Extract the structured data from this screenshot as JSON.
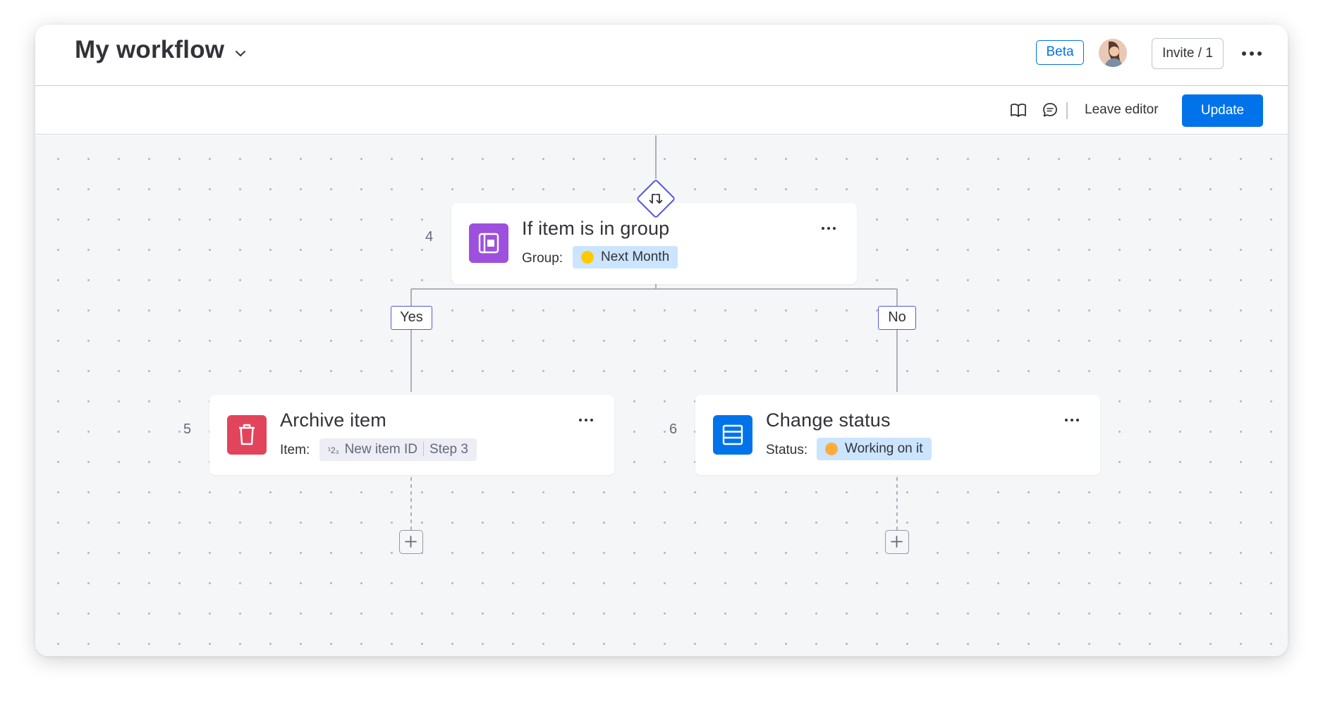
{
  "header": {
    "title": "My workflow",
    "beta_label": "Beta",
    "invite_label": "Invite / 1"
  },
  "toolbar": {
    "leave_editor_label": "Leave editor",
    "update_label": "Update"
  },
  "nodes": {
    "condition": {
      "step": "4",
      "title": "If item is in group",
      "field_label": "Group:",
      "value": "Next Month",
      "value_color": "#ffcb00",
      "icon": "group-board-icon",
      "icon_color": "#9d50dd"
    },
    "yes_action": {
      "step": "5",
      "title": "Archive item",
      "field_label": "Item:",
      "value_prefix": "¹2₃",
      "value": "New item ID",
      "value_suffix": "Step 3",
      "icon": "trash-icon",
      "icon_color": "#e2445c"
    },
    "no_action": {
      "step": "6",
      "title": "Change status",
      "field_label": "Status:",
      "value": "Working on it",
      "value_color": "#fdab3d",
      "icon": "status-column-icon",
      "icon_color": "#0073ea"
    }
  },
  "branches": {
    "yes_label": "Yes",
    "no_label": "No"
  },
  "colors": {
    "accent": "#0073ea",
    "branch_outline": "#5559df",
    "pill_bg": "#cce5ff",
    "canvas_bg": "#f5f6f8"
  }
}
